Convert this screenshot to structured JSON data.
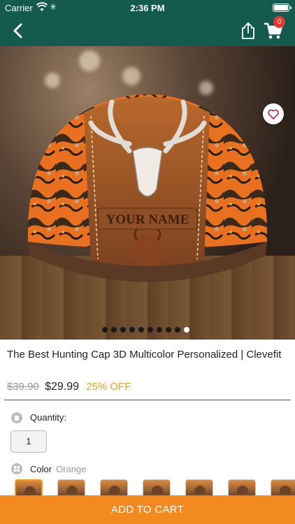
{
  "status_bar": {
    "carrier": "Carrier",
    "time": "2:36 PM"
  },
  "nav": {
    "back_icon": "chevron-left-icon",
    "share_icon": "share-icon",
    "cart_icon": "cart-icon",
    "cart_count": "0"
  },
  "gallery": {
    "image_count": 10,
    "active_index": 9,
    "hero_text": "YOUR NAME"
  },
  "product": {
    "title": "The Best Hunting Cap 3D Multicolor Personalized | Clevefit",
    "old_price": "$39.90",
    "price": "$29.99",
    "discount": "25% OFF"
  },
  "options": {
    "quantity_label": "Quantity:",
    "quantity_value": "1",
    "color_label": "Color",
    "color_value": "Orange",
    "swatch_count": 7,
    "selected_swatch": 0
  },
  "actions": {
    "add_to_cart": "ADD TO CART"
  },
  "colors": {
    "header": "#155a4e",
    "accent": "#f28a1f",
    "discount": "#f0a020",
    "badge": "#e53935"
  }
}
